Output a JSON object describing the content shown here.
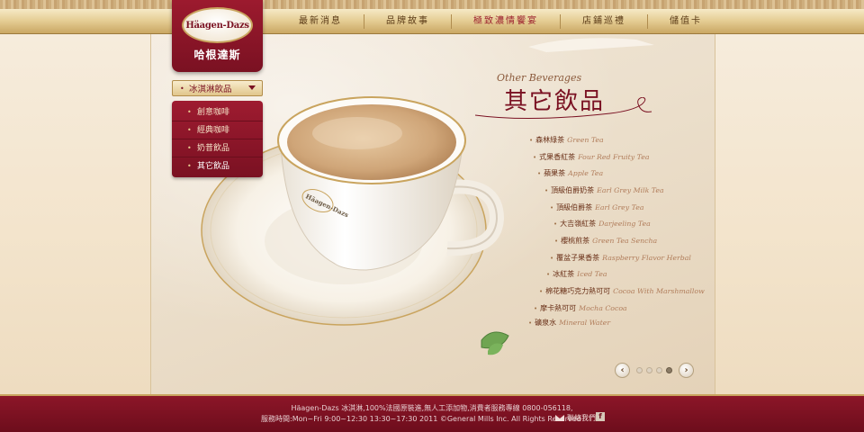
{
  "nav": {
    "items": [
      "最新消息",
      "品牌故事",
      "極致濃情饗宴",
      "店鋪巡禮",
      "儲值卡"
    ],
    "active_index": 2
  },
  "logo": {
    "brand_en": "Häagen-Dazs",
    "brand_cn": "哈根達斯"
  },
  "sidebar": {
    "dropdown_label": "冰淇淋飲品",
    "items": [
      "創意咖啡",
      "經典咖啡",
      "奶昔飲品",
      "其它飲品"
    ],
    "active_index": 3
  },
  "content": {
    "subtitle_en": "Other Beverages",
    "title_cn": "其它飲品",
    "beverages": [
      {
        "cn": "森林綠茶",
        "en": "Green Tea"
      },
      {
        "cn": "式果香紅茶",
        "en": "Four Red Fruity Tea"
      },
      {
        "cn": "蘋果茶",
        "en": "Apple Tea"
      },
      {
        "cn": "頂級伯爵奶茶",
        "en": "Earl Grey Milk Tea"
      },
      {
        "cn": "頂級伯爵茶",
        "en": "Earl Grey Tea"
      },
      {
        "cn": "大吉嶺紅茶",
        "en": "Darjeeling Tea"
      },
      {
        "cn": "櫻桃煎茶",
        "en": "Green Tea Sencha"
      },
      {
        "cn": "覆盆子果香茶",
        "en": "Raspberry Flavor Herbal"
      },
      {
        "cn": "冰紅茶",
        "en": "Iced Tea"
      },
      {
        "cn": "棉花糖巧克力熱可可",
        "en": "Cocoa With Marshmallow"
      },
      {
        "cn": "摩卡熱可可",
        "en": "Mocha Cocoa"
      },
      {
        "cn": "礦泉水",
        "en": "Mineral Water"
      }
    ],
    "cup_brand": "Häagen-Dazs"
  },
  "pager": {
    "prev": "‹",
    "next": "›",
    "dots": 4,
    "active_index": 3
  },
  "footer": {
    "line1": "Häagen-Dazs 冰淇淋,100%法國原裝進,無人工添加物,消費者服務專線 0800-056118,",
    "line2": "服務時間:Mon~Fri 9:00~12:30 13:30~17:30  2011 ©General Mills Inc. All Rights Reserved",
    "contact_label": "聯絡我們",
    "facebook": "f"
  },
  "colors": {
    "brand_red": "#7a1122",
    "gold": "#c9a45e",
    "cream": "#f2e6d2"
  },
  "icons": [
    "mail-icon",
    "facebook-icon",
    "chevron-left-icon",
    "chevron-right-icon",
    "dropdown-arrow-icon"
  ]
}
